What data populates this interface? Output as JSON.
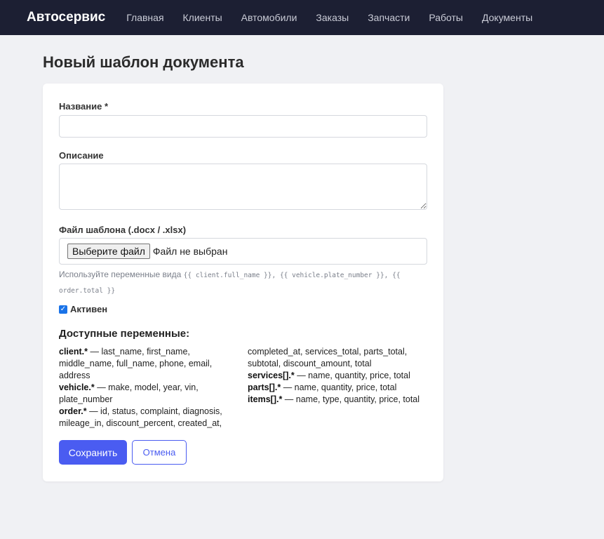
{
  "nav": {
    "brand": "Автосервис",
    "links": [
      "Главная",
      "Клиенты",
      "Автомобили",
      "Заказы",
      "Запчасти",
      "Работы",
      "Документы"
    ]
  },
  "page": {
    "title": "Новый шаблон документа"
  },
  "form": {
    "name_label": "Название *",
    "name_value": "",
    "description_label": "Описание",
    "description_value": "",
    "file_label": "Файл шаблона (.docx / .xlsx)",
    "file_button": "Выберите файл",
    "file_status": "Файл не выбран",
    "hint_prefix": "Используйте переменные вида ",
    "hint_var1": "{{ client.full_name }}",
    "hint_var2": "{{ vehicle.plate_number }}",
    "hint_var3": "{{ order.total }}",
    "hint_sep": ", ",
    "active_label": "Активен",
    "active_checked": true
  },
  "variables": {
    "title": "Доступные переменные:",
    "groups": [
      {
        "key": "client.*",
        "text": " — last_name, first_name, middle_name, full_name, phone, email, address"
      },
      {
        "key": "vehicle.*",
        "text": " — make, model, year, vin, plate_number"
      },
      {
        "key": "order.*",
        "text": " — id, status, complaint, diagnosis, mileage_in, discount_percent, created_at,"
      },
      {
        "key": "",
        "text": "completed_at, services_total, parts_total, subtotal, discount_amount, total"
      },
      {
        "key": "services[].*",
        "text": " — name, quantity, price, total"
      },
      {
        "key": "parts[].*",
        "text": " — name, quantity, price, total"
      },
      {
        "key": "items[].*",
        "text": " — name, type, quantity, price, total"
      }
    ]
  },
  "actions": {
    "save": "Сохранить",
    "cancel": "Отмена"
  },
  "colors": {
    "navbar": "#1c1f33",
    "primary": "#4a5cf1",
    "checkbox": "#1a73e8"
  }
}
